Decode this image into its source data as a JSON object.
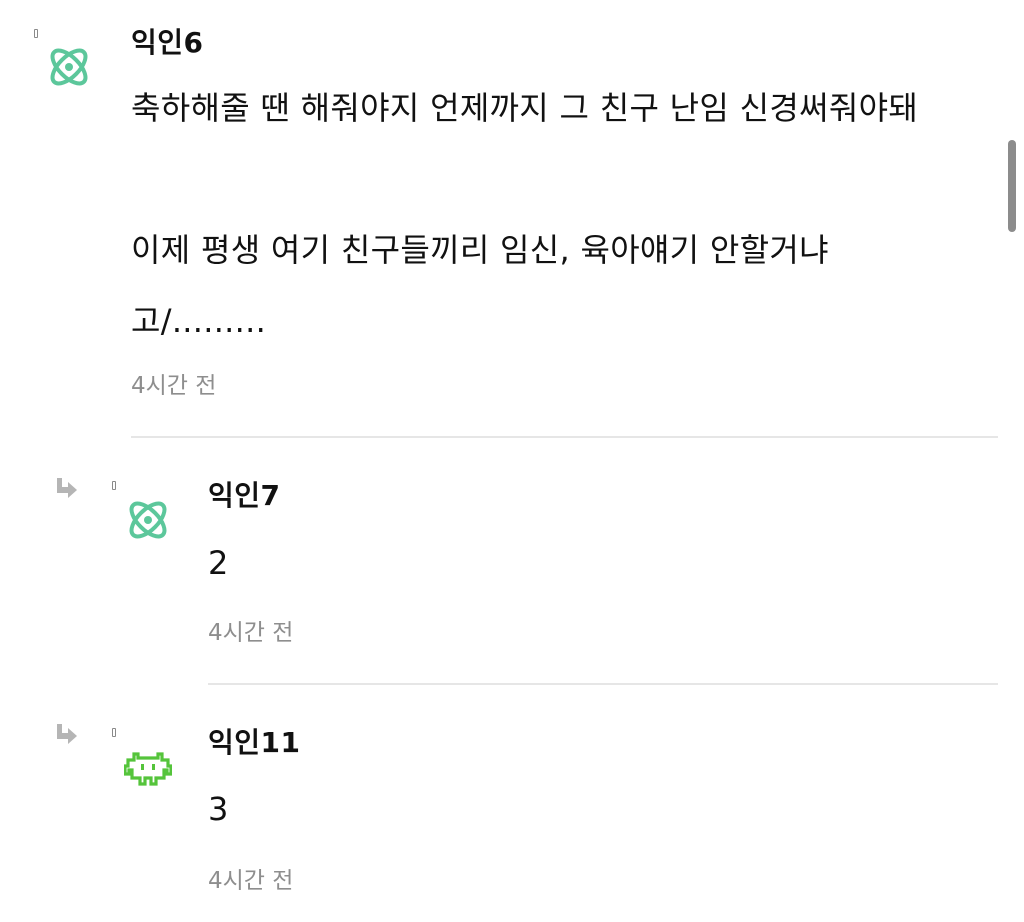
{
  "comments": [
    {
      "author": "익인6",
      "avatar_icon": "atom-icon",
      "body": "축하해줄 땐 해줘야지 언제까지 그 친구 난임 신경써줘야돼\n\n이제 평생 여기 친구들끼리 임신, 육아얘기 안할거냐\n고/.........",
      "time": "4시간 전"
    },
    {
      "author": "익인7",
      "avatar_icon": "atom-icon",
      "body": "2",
      "time": "4시간 전",
      "is_reply": true
    },
    {
      "author": "익인11",
      "avatar_icon": "space-invader-icon",
      "body": "3",
      "time": "4시간 전",
      "is_reply": true
    }
  ],
  "colors": {
    "atom_icon": "#5cc79b",
    "invader_icon": "#55c43b",
    "time_text": "#8e8e8e",
    "reply_arrow": "#b5b5b5",
    "divider": "#e6e6e6"
  }
}
